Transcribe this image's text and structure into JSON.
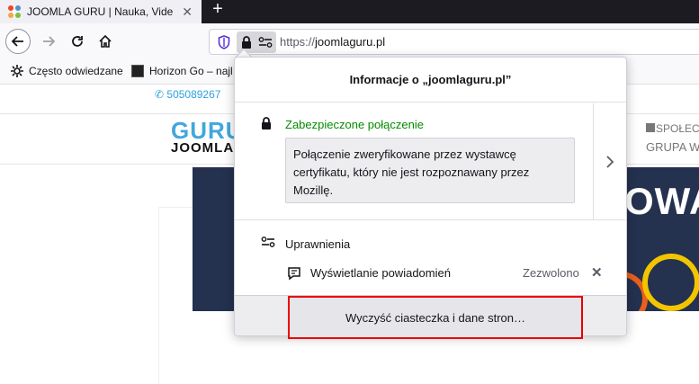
{
  "tab": {
    "title": "JOOMLA GURU | Nauka, Video",
    "close_icon": "close-icon",
    "new_tab_label": "+"
  },
  "navbar": {
    "url_scheme": "https://",
    "url_host": "joomlaguru.pl"
  },
  "bookmarks": {
    "items": [
      {
        "label": "Często odwiedzane",
        "icon": "gear-icon"
      },
      {
        "label": "Horizon Go – najl",
        "icon": "site-favicon"
      }
    ]
  },
  "page": {
    "phone": "505089267",
    "logo_top": "GURU",
    "logo_bottom": "JOOMLA",
    "social_1": "SPOŁEC",
    "social_2": "GRUPA W",
    "banner_text": "OWA"
  },
  "panel": {
    "title": "Informacje o „joomlaguru.pl”",
    "security": {
      "title": "Zabezpieczone połączenie",
      "detail": "Połączenie zweryfikowane przez wystawcę certyfikatu, który nie jest rozpoznawany przez Mozillę."
    },
    "permissions": {
      "title": "Uprawnienia",
      "items": [
        {
          "label": "Wyświetlanie powiadomień",
          "state": "Zezwolono"
        }
      ]
    },
    "clear_button": "Wyczyść ciasteczka i dane stron…"
  },
  "colors": {
    "secure_green": "#058b00",
    "highlight_red": "#ee0000",
    "brand_blue": "#42a7dd"
  }
}
